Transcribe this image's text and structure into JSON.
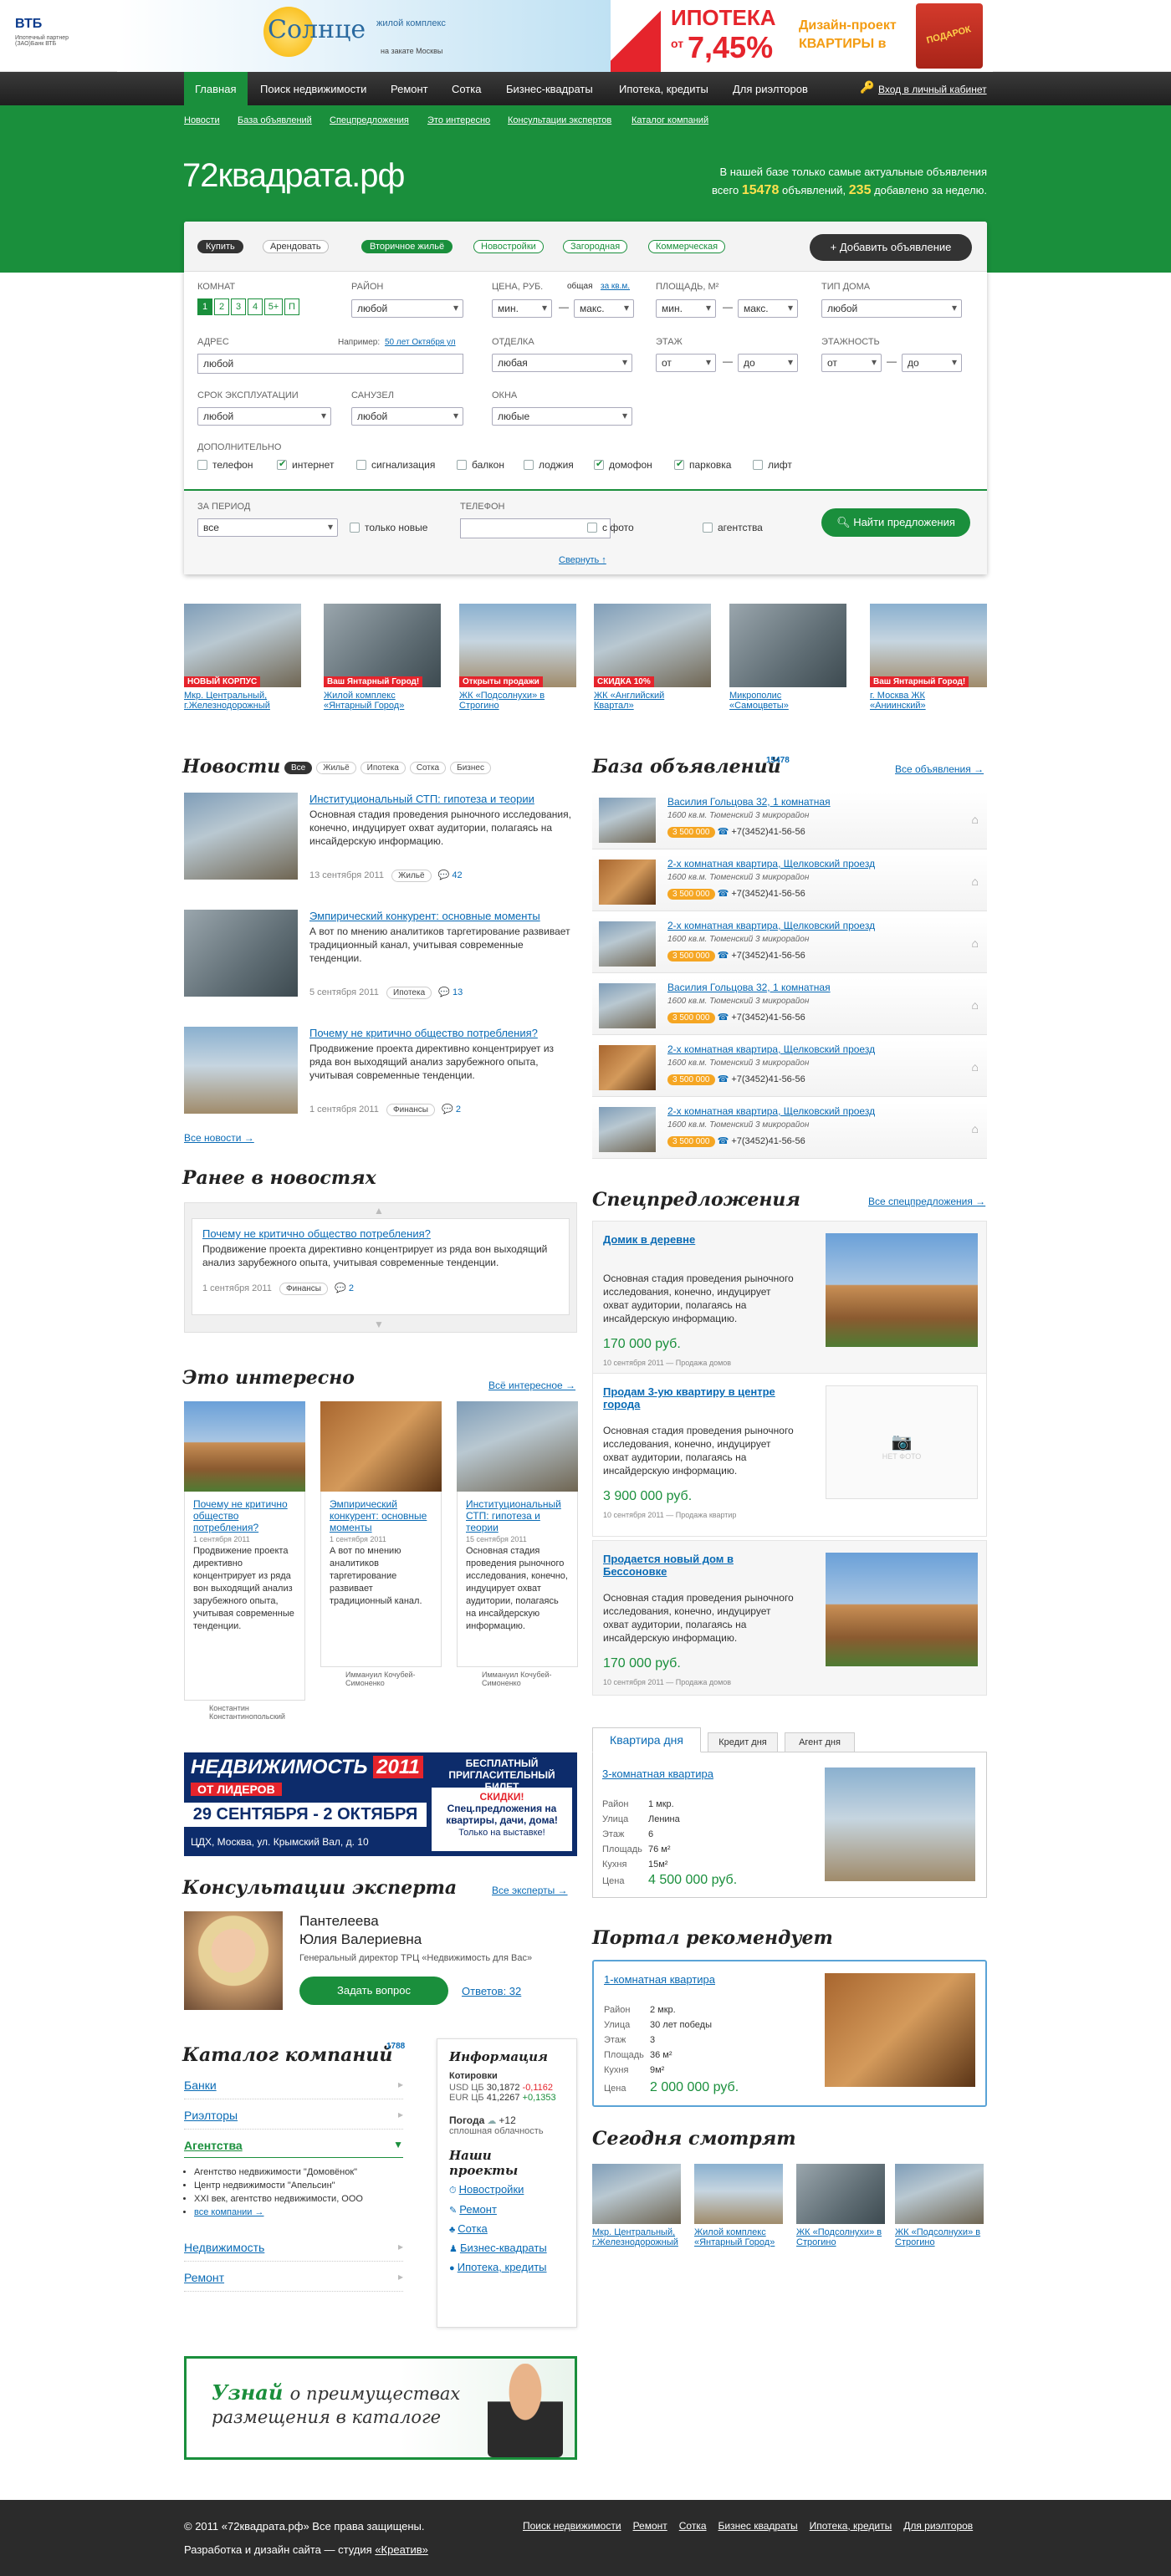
{
  "topbar": {
    "vtb": "ВТБ",
    "vtb_sub": "Ипотечный партнер\n(ЗАО)Банк ВТБ",
    "sun_title": "Солнце",
    "sun_sub": "жилой комплекс",
    "sun_sub2": "на закате Москвы",
    "ad_title": "ИПОТЕКА",
    "ad_from": "от",
    "ad_rate": "7,45%",
    "ad_design": "Дизайн-проект",
    "ad_flats": "КВАРТИРЫ в",
    "ad_gift": "ПОДАРОК"
  },
  "nav": {
    "items": [
      "Главная",
      "Поиск недвижимости",
      "Ремонт",
      "Сотка",
      "Бизнес-квадраты",
      "Ипотека, кредиты",
      "Для риэлторов"
    ],
    "login": "Вход в личный кабинет"
  },
  "subnav": [
    "Новости",
    "База объявлений",
    "Спецпредложения",
    "Это интересно",
    "Консультации экспертов",
    "Каталог компаний"
  ],
  "hero": {
    "logo": "72квадрата.рф",
    "text1": "В нашей базе только самые актуальные объявления",
    "text2a": "всего",
    "count1": "15478",
    "text2b": "объявлений,",
    "count2": "235",
    "text2c": "добавлено за неделю."
  },
  "search": {
    "tabs": [
      "Купить",
      "Арендовать"
    ],
    "types": [
      "Вторичное жильё",
      "Новостройки",
      "Загородная",
      "Коммерческая"
    ],
    "add_btn": "Добавить объявление",
    "rooms_label": "КОМНАТ",
    "rooms": [
      "1",
      "2",
      "3",
      "4",
      "5+",
      "П"
    ],
    "region_label": "РАЙОН",
    "region": "любой",
    "price_label": "ЦЕНА, РУБ.",
    "price_total": "общая",
    "price_sqm": "за кв.м.",
    "price_min": "мин.",
    "price_max": "макс.",
    "area_label": "ПЛОЩАДЬ, М²",
    "area_min": "мин.",
    "area_max": "макс.",
    "house_label": "ТИП ДОМА",
    "house": "любой",
    "address_label": "АДРЕС",
    "address_example": "Например:",
    "address_example_link": "50 лет Октября ул",
    "address": "любой",
    "finish_label": "ОТДЕЛКА",
    "finish": "любая",
    "floor_label": "ЭТАЖ",
    "floor_from": "от",
    "floor_to": "до",
    "floors_label": "ЭТАЖНОСТЬ",
    "floors_from": "от",
    "floors_to": "до",
    "period_label": "СРОК ЭКСПЛУАТАЦИИ",
    "period": "любой",
    "bath_label": "САНУЗЕЛ",
    "bath": "любой",
    "windows_label": "ОКНА",
    "windows": "любые",
    "extra_label": "ДОПОЛНИТЕЛЬНО",
    "extras": [
      "телефон",
      "интернет",
      "сигнализация",
      "балкон",
      "лоджия",
      "домофон",
      "парковка",
      "лифт"
    ],
    "for_period_label": "ЗА ПЕРИОД",
    "for_period": "все",
    "only_new": "только новые",
    "phone_label": "ТЕЛЕФОН",
    "with_photo": "с фото",
    "agency": "агентства",
    "find_btn": "Найти предложения",
    "collapse": "Свернуть ↑"
  },
  "banners": [
    {
      "caption": "Мкр. Центральный, г.Железнодорожный",
      "tag": "НОВЫЙ КОРПУС"
    },
    {
      "caption": "Жилой комплекс «Янтарный Город»",
      "tag": "Ваш Янтарный Город!"
    },
    {
      "caption": "ЖК «Подсолнухи» в Строгино",
      "tag": "Открыты продажи"
    },
    {
      "caption": "ЖК «Английский Квартал»",
      "tag": "СКИДКА 10%"
    },
    {
      "caption": "Микрополис «Самоцветы»",
      "tag": ""
    },
    {
      "caption": "г. Москва ЖК «Аниинский»",
      "tag": "Ваш Янтарный Город!"
    }
  ],
  "news": {
    "title": "Новости",
    "filters": [
      "Все",
      "Жильё",
      "Ипотека",
      "Сотка",
      "Бизнес"
    ],
    "items": [
      {
        "title": "Институциональный СТП: гипотеза и теории",
        "text": "Основная стадия проведения рыночного исследования, конечно, индуцирует охват аудитории, полагаясь на инсайдерскую информацию.",
        "date": "13 сентября 2011",
        "tag": "Жильё",
        "comments": "42"
      },
      {
        "title": "Эмпирический конкурент: основные моменты",
        "text": "А вот по мнению аналитиков таргетирование развивает традиционный канал, учитывая современные тенденции.",
        "date": "5 сентября 2011",
        "tag": "Ипотека",
        "comments": "13"
      },
      {
        "title": "Почему не критично общество потребления?",
        "text": "Продвижение проекта директивно концентрирует из ряда вон выходящий анализ зарубежного опыта, учитывая современные тенденции.",
        "date": "1 сентября 2011",
        "tag": "Финансы",
        "comments": "2"
      }
    ],
    "all": "Все новости →"
  },
  "earlier": {
    "title": "Ранее в новостях",
    "item_title": "Почему не критично общество потребления?",
    "item_text": "Продвижение проекта директивно концентрирует из ряда вон выходящий анализ зарубежного опыта, учитывая современные тенденции.",
    "date": "1 сентября 2011",
    "tag": "Финансы",
    "comments": "2"
  },
  "base": {
    "title": "База объявлений",
    "count": "15478",
    "all": "Все объявления →",
    "items": [
      {
        "title": "Василия Гольцова 32, 1 комнатная",
        "meta": "1600 кв.м. Тюменский 3 микрорайон",
        "price": "3 500 000",
        "phone": "+7(3452)41-56-56"
      },
      {
        "title": "2-х комнатная квартира, Щелковский проезд",
        "meta": "1600 кв.м. Тюменский 3 микрорайон",
        "price": "3 500 000",
        "phone": "+7(3452)41-56-56"
      },
      {
        "title": "2-х комнатная квартира, Щелковский проезд",
        "meta": "1600 кв.м. Тюменский 3 микрорайон",
        "price": "3 500 000",
        "phone": "+7(3452)41-56-56"
      },
      {
        "title": "Василия Гольцова 32, 1 комнатная",
        "meta": "1600 кв.м. Тюменский 3 микрорайон",
        "price": "3 500 000",
        "phone": "+7(3452)41-56-56"
      },
      {
        "title": "2-х комнатная квартира, Щелковский проезд",
        "meta": "1600 кв.м. Тюменский 3 микрорайон",
        "price": "3 500 000",
        "phone": "+7(3452)41-56-56"
      },
      {
        "title": "2-х комнатная квартира, Щелковский проезд",
        "meta": "1600 кв.м. Тюменский 3 микрорайон",
        "price": "3 500 000",
        "phone": "+7(3452)41-56-56"
      }
    ]
  },
  "interesting": {
    "title": "Это интересно",
    "all": "Всё интересное →",
    "items": [
      {
        "title": "Почему не критично общество потребления?",
        "date": "1 сентября 2011",
        "text": "Продвижение проекта директивно концентрирует из ряда вон выходящий анализ зарубежного опыта, учитывая современные тенденции.",
        "author": "Константин Константинопольский"
      },
      {
        "title": "Эмпирический конкурент: основные моменты",
        "date": "1 сентября 2011",
        "text": "А вот по мнению аналитиков таргетирование развивает традиционный канал.",
        "author": "Иммануил Кочубей-Симоненко"
      },
      {
        "title": "Институциональный СТП: гипотеза и теории",
        "date": "15 сентября 2011",
        "text": "Основная стадия проведения рыночного исследования, конечно, индуцирует охват аудитории, полагаясь на инсайдерскую информацию.",
        "author": "Иммануил Кочубей-Симоненко"
      }
    ]
  },
  "special": {
    "title": "Спецпредложения",
    "all": "Все спецпредложения →",
    "items": [
      {
        "title": "Домик в деревне",
        "text": "Основная стадия проведения рыночного исследования, конечно, индуцирует охват аудитории, полагаясь на инсайдерскую информацию.",
        "price": "170 000 руб.",
        "date": "10 сентября 2011 — Продажа домов"
      },
      {
        "title": "Продам 3-ую квартиру в центре города",
        "text": "Основная стадия проведения рыночного исследования, конечно, индуцирует охват аудитории, полагаясь на инсайдерскую информацию.",
        "price": "3 900 000 руб.",
        "date": "10 сентября 2011 — Продажа квартир"
      },
      {
        "title": "Продается новый дом в Бессоновке",
        "text": "Основная стадия проведения рыночного исследования, конечно, индуцирует охват аудитории, полагаясь на инсайдерскую информацию.",
        "price": "170 000 руб.",
        "date": "10 сентября 2011 — Продажа домов"
      }
    ],
    "nophoto": "НЕТ ФОТО"
  },
  "expo": {
    "title": "НЕДВИЖИМОСТЬ",
    "year": "2011",
    "sub": "ОТ ЛИДЕРОВ",
    "dates": "29 СЕНТЯБРЯ - 2 ОКТЯБРЯ",
    "place": "ЦДХ, Москва, ул. Крымский Вал, д. 10",
    "free": "БЕСПЛАТНЫЙ ПРИГЛАСИТЕЛЬНЫЙ БИЛЕТ",
    "discount": "СКИДКИ!",
    "offer": "Спец.предложения на квартиры, дачи, дома!",
    "only": "Только на выставке!"
  },
  "day": {
    "tabs": [
      "Квартира дня",
      "Кредит дня",
      "Агент дня"
    ],
    "title": "3-комнатная квартира",
    "rows": [
      [
        "Район",
        "1 мкр."
      ],
      [
        "Улица",
        "Ленина"
      ],
      [
        "Этаж",
        "6"
      ],
      [
        "Площадь",
        "76 м²"
      ],
      [
        "Кухня",
        "15м²"
      ]
    ],
    "price_label": "Цена",
    "price": "4 500 000 руб."
  },
  "expert": {
    "title": "Консультации эксперта",
    "all": "Все эксперты →",
    "name1": "Пантелеева",
    "name2": "Юлия Валериевна",
    "role": "Генеральный директор ТРЦ «Недвижимость для Вас»",
    "ask": "Задать вопрос",
    "answers": "Ответов: 32"
  },
  "recommend": {
    "title": "Портал рекомендует",
    "item": "1-комнатная квартира",
    "rows": [
      [
        "Район",
        "2 мкр."
      ],
      [
        "Улица",
        "30 лет победы"
      ],
      [
        "Этаж",
        "3"
      ],
      [
        "Площадь",
        "36 м²"
      ],
      [
        "Кухня",
        "9м²"
      ]
    ],
    "price_label": "Цена",
    "price": "2 000 000 руб."
  },
  "catalog": {
    "title": "Каталог компаний",
    "count": "1788",
    "cats": [
      "Банки",
      "Риэлторы",
      "Агентства",
      "Недвижимость",
      "Ремонт"
    ],
    "agencies": [
      "Агентство недвижимости \"Домовёнок\"",
      "Центр недвижимости \"Апельсин\"",
      "XXI век, агентство недвижимости, ООО"
    ],
    "all": "все компании →"
  },
  "info": {
    "title": "Информация",
    "quotes": "Котировки",
    "usd": "USD ЦБ",
    "usd_v": "30,1872",
    "usd_d": "-0,1162",
    "eur": "EUR ЦБ",
    "eur_v": "41,2267",
    "eur_d": "+0,1353",
    "weather": "Погода",
    "temp": "+12",
    "weather_sub": "сплошная облачность",
    "projects": "Наши проекты",
    "project_items": [
      "Новостройки",
      "Ремонт",
      "Сотка",
      "Бизнес-квадраты",
      "Ипотека, кредиты"
    ]
  },
  "watch": {
    "title": "Сегодня смотрят",
    "items": [
      "Мкр. Центральный, г.Железнодорожный",
      "Жилой комплекс «Янтарный Город»",
      "ЖК «Подсолнухи» в Строгино",
      "ЖК «Подсолнухи» в Строгино"
    ]
  },
  "promo": {
    "line1a": "Узнай",
    "line1b": "о преимуществах",
    "line2": "размещения в каталоге"
  },
  "footer": {
    "copy": "© 2011 «72квадрата.рф» Все права защищены.",
    "dev": "Разработка и дизайн сайта — студия",
    "studio": "«Креатив»",
    "links": [
      "Поиск недвижимости",
      "Ремонт",
      "Сотка",
      "Бизнес квадраты",
      "Ипотека, кредиты",
      "Для риэлторов"
    ]
  }
}
